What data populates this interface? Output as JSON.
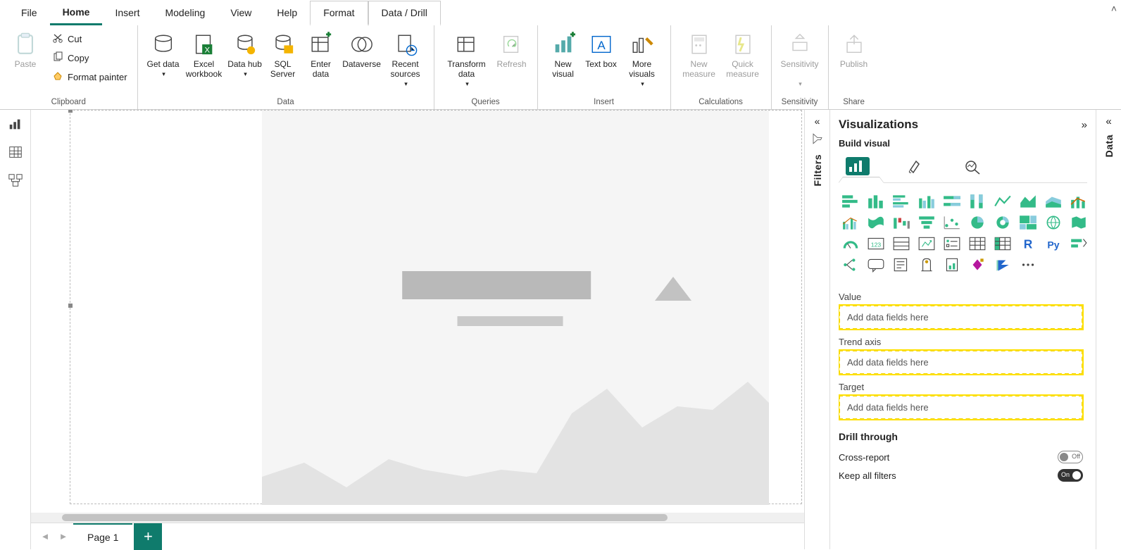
{
  "menu_tabs": {
    "file": "File",
    "home": "Home",
    "insert": "Insert",
    "modeling": "Modeling",
    "view": "View",
    "help": "Help",
    "format": "Format",
    "data_drill": "Data / Drill",
    "active": "Home",
    "contextual": [
      "Format",
      "Data / Drill"
    ]
  },
  "ribbon": {
    "clipboard": {
      "group_label": "Clipboard",
      "paste": "Paste",
      "cut": "Cut",
      "copy": "Copy",
      "format_painter": "Format painter"
    },
    "data": {
      "group_label": "Data",
      "get_data": "Get data",
      "excel_workbook": "Excel workbook",
      "data_hub": "Data hub",
      "sql_server": "SQL Server",
      "enter_data": "Enter data",
      "dataverse": "Dataverse",
      "recent_sources": "Recent sources"
    },
    "queries": {
      "group_label": "Queries",
      "transform_data": "Transform data",
      "refresh": "Refresh"
    },
    "insert": {
      "group_label": "Insert",
      "new_visual": "New visual",
      "text_box": "Text box",
      "more_visuals": "More visuals"
    },
    "calculations": {
      "group_label": "Calculations",
      "new_measure": "New measure",
      "quick_measure": "Quick measure"
    },
    "sensitivity": {
      "group_label": "Sensitivity",
      "label": "Sensitivity"
    },
    "share": {
      "group_label": "Share",
      "publish": "Publish"
    }
  },
  "page_tabs": {
    "page1": "Page 1"
  },
  "filters_pane": {
    "title": "Filters"
  },
  "viz_pane": {
    "title": "Visualizations",
    "subtitle": "Build visual",
    "wells": {
      "value": {
        "label": "Value",
        "placeholder": "Add data fields here"
      },
      "trend_axis": {
        "label": "Trend axis",
        "placeholder": "Add data fields here"
      },
      "target": {
        "label": "Target",
        "placeholder": "Add data fields here"
      }
    },
    "drill_through": {
      "title": "Drill through",
      "cross_report": {
        "label": "Cross-report",
        "state": "Off"
      },
      "keep_filters": {
        "label": "Keep all filters",
        "state": "On"
      }
    }
  },
  "data_pane": {
    "title": "Data"
  }
}
